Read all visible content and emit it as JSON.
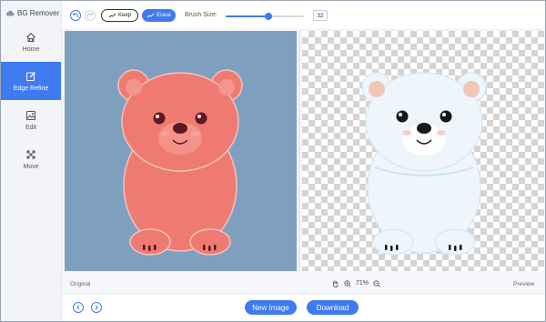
{
  "app": {
    "title": "BG Remover"
  },
  "sidebar": {
    "items": [
      {
        "label": "Home",
        "icon": "home-icon",
        "active": false
      },
      {
        "label": "Edge Refine",
        "icon": "edge-refine-icon",
        "active": true
      },
      {
        "label": "Edit",
        "icon": "image-edit-icon",
        "active": false
      },
      {
        "label": "Move",
        "icon": "move-arrows-icon",
        "active": false
      }
    ]
  },
  "toolbar": {
    "keep_label": "Keep",
    "erase_label": "Erase",
    "brush_size_label": "Brush Size:",
    "brush_size_value": "32",
    "brush_size_fraction": 0.55
  },
  "status": {
    "original_label": "Original",
    "preview_label": "Preview",
    "zoom": "71%"
  },
  "actions": {
    "new_image_label": "New Image",
    "download_label": "Download"
  },
  "colors": {
    "accent": "#3f7bf0",
    "original_bg": "#7f9fbf",
    "bear_red": "#ef7a72",
    "bear_white": "#e8f3fb"
  }
}
